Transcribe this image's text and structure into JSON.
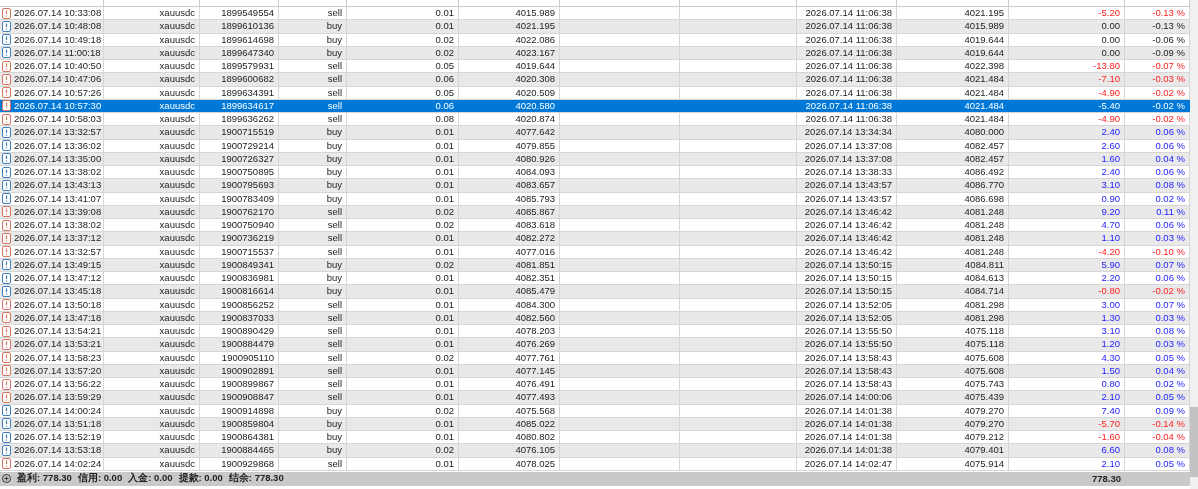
{
  "rows": [
    {
      "kind": "sell",
      "time": "2026.07.14 10:33:08",
      "symbol": "xauusdc",
      "ticket": "1899549554",
      "type": "sell",
      "volume": "0.01",
      "price": "4015.989",
      "close_time": "2026.07.14 11:06:38",
      "close_price": "4021.195",
      "profit": {
        "kind": "loss",
        "value": "-5.20",
        "pct": "-0.13 %"
      },
      "selected": false
    },
    {
      "kind": "buy",
      "time": "2026.07.14 10:48:08",
      "symbol": "xauusdc",
      "ticket": "1899610136",
      "type": "buy",
      "volume": "0.01",
      "price": "4021.195",
      "close_time": "2026.07.14 11:06:38",
      "close_price": "4015.989",
      "profit": {
        "kind": "even",
        "value": "0.00",
        "pct": "-0.13 %"
      },
      "selected": false
    },
    {
      "kind": "buy",
      "time": "2026.07.14 10:49:18",
      "symbol": "xauusdc",
      "ticket": "1899614698",
      "type": "buy",
      "volume": "0.02",
      "price": "4022.086",
      "close_time": "2026.07.14 11:06:38",
      "close_price": "4019.644",
      "profit": {
        "kind": "even",
        "value": "0.00",
        "pct": "-0.06 %"
      },
      "selected": false
    },
    {
      "kind": "buy",
      "time": "2026.07.14 11:00:18",
      "symbol": "xauusdc",
      "ticket": "1899647340",
      "type": "buy",
      "volume": "0.02",
      "price": "4023.167",
      "close_time": "2026.07.14 11:06:38",
      "close_price": "4019.644",
      "profit": {
        "kind": "even",
        "value": "0.00",
        "pct": "-0.09 %"
      },
      "selected": false
    },
    {
      "kind": "sell",
      "time": "2026.07.14 10:40:50",
      "symbol": "xauusdc",
      "ticket": "1899579931",
      "type": "sell",
      "volume": "0.05",
      "price": "4019.644",
      "close_time": "2026.07.14 11:06:38",
      "close_price": "4022.398",
      "profit": {
        "kind": "loss",
        "value": "-13.80",
        "pct": "-0.07 %"
      },
      "selected": false
    },
    {
      "kind": "sell",
      "time": "2026.07.14 10:47:06",
      "symbol": "xauusdc",
      "ticket": "1899600682",
      "type": "sell",
      "volume": "0.06",
      "price": "4020.308",
      "close_time": "2026.07.14 11:06:38",
      "close_price": "4021.484",
      "profit": {
        "kind": "loss",
        "value": "-7.10",
        "pct": "-0.03 %"
      },
      "selected": false
    },
    {
      "kind": "sell",
      "time": "2026.07.14 10:57:26",
      "symbol": "xauusdc",
      "ticket": "1899634391",
      "type": "sell",
      "volume": "0.05",
      "price": "4020.509",
      "close_time": "2026.07.14 11:06:38",
      "close_price": "4021.484",
      "profit": {
        "kind": "loss",
        "value": "-4.90",
        "pct": "-0.02 %"
      },
      "selected": false
    },
    {
      "kind": "sell",
      "time": "2026.07.14 10:57:30",
      "symbol": "xauusdc",
      "ticket": "1899634617",
      "type": "sell",
      "volume": "0.06",
      "price": "4020.580",
      "close_time": "2026.07.14 11:06:38",
      "close_price": "4021.484",
      "profit": {
        "value": "-5.40",
        "pct": "-0.02 %"
      },
      "selected": true
    },
    {
      "kind": "sell",
      "time": "2026.07.14 10:58:03",
      "symbol": "xauusdc",
      "ticket": "1899636262",
      "type": "sell",
      "volume": "0.08",
      "price": "4020.874",
      "close_time": "2026.07.14 11:06:38",
      "close_price": "4021.484",
      "profit": {
        "kind": "loss",
        "value": "-4.90",
        "pct": "-0.02 %"
      },
      "selected": false
    },
    {
      "kind": "buy",
      "time": "2026.07.14 13:32:57",
      "symbol": "xauusdc",
      "ticket": "1900715519",
      "type": "buy",
      "volume": "0.01",
      "price": "4077.642",
      "close_time": "2026.07.14 13:34:34",
      "close_price": "4080.000",
      "profit": {
        "kind": "gain",
        "value": "2.40",
        "pct": "0.06 %"
      },
      "selected": false
    },
    {
      "kind": "buy",
      "time": "2026.07.14 13:36:02",
      "symbol": "xauusdc",
      "ticket": "1900729214",
      "type": "buy",
      "volume": "0.01",
      "price": "4079.855",
      "close_time": "2026.07.14 13:37:08",
      "close_price": "4082.457",
      "profit": {
        "kind": "gain",
        "value": "2.60",
        "pct": "0.06 %"
      },
      "selected": false
    },
    {
      "kind": "buy",
      "time": "2026.07.14 13:35:00",
      "symbol": "xauusdc",
      "ticket": "1900726327",
      "type": "buy",
      "volume": "0.01",
      "price": "4080.926",
      "close_time": "2026.07.14 13:37:08",
      "close_price": "4082.457",
      "profit": {
        "kind": "gain",
        "value": "1.60",
        "pct": "0.04 %"
      },
      "selected": false
    },
    {
      "kind": "buy",
      "time": "2026.07.14 13:38:02",
      "symbol": "xauusdc",
      "ticket": "1900750895",
      "type": "buy",
      "volume": "0.01",
      "price": "4084.093",
      "close_time": "2026.07.14 13:38:33",
      "close_price": "4086.492",
      "profit": {
        "kind": "gain",
        "value": "2.40",
        "pct": "0.06 %"
      },
      "selected": false
    },
    {
      "kind": "buy",
      "time": "2026.07.14 13:43:13",
      "symbol": "xauusdc",
      "ticket": "1900795693",
      "type": "buy",
      "volume": "0.01",
      "price": "4083.657",
      "close_time": "2026.07.14 13:43:57",
      "close_price": "4086.770",
      "profit": {
        "kind": "gain",
        "value": "3.10",
        "pct": "0.08 %"
      },
      "selected": false
    },
    {
      "kind": "buy",
      "time": "2026.07.14 13:41:07",
      "symbol": "xauusdc",
      "ticket": "1900783409",
      "type": "buy",
      "volume": "0.01",
      "price": "4085.793",
      "close_time": "2026.07.14 13:43:57",
      "close_price": "4086.698",
      "profit": {
        "kind": "gain",
        "value": "0.90",
        "pct": "0.02 %"
      },
      "selected": false
    },
    {
      "kind": "sell",
      "time": "2026.07.14 13:39:08",
      "symbol": "xauusdc",
      "ticket": "1900762170",
      "type": "sell",
      "volume": "0.02",
      "price": "4085.867",
      "close_time": "2026.07.14 13:46:42",
      "close_price": "4081.248",
      "profit": {
        "kind": "gain",
        "value": "9.20",
        "pct": "0.11 %"
      },
      "selected": false
    },
    {
      "kind": "sell",
      "time": "2026.07.14 13:38:02",
      "symbol": "xauusdc",
      "ticket": "1900750940",
      "type": "sell",
      "volume": "0.02",
      "price": "4083.618",
      "close_time": "2026.07.14 13:46:42",
      "close_price": "4081.248",
      "profit": {
        "kind": "gain",
        "value": "4.70",
        "pct": "0.06 %"
      },
      "selected": false
    },
    {
      "kind": "sell",
      "time": "2026.07.14 13:37:12",
      "symbol": "xauusdc",
      "ticket": "1900736219",
      "type": "sell",
      "volume": "0.01",
      "price": "4082.272",
      "close_time": "2026.07.14 13:46:42",
      "close_price": "4081.248",
      "profit": {
        "kind": "gain",
        "value": "1.10",
        "pct": "0.03 %"
      },
      "selected": false
    },
    {
      "kind": "sell",
      "time": "2026.07.14 13:32:57",
      "symbol": "xauusdc",
      "ticket": "1900715537",
      "type": "sell",
      "volume": "0.01",
      "price": "4077.016",
      "close_time": "2026.07.14 13:46:42",
      "close_price": "4081.248",
      "profit": {
        "kind": "loss",
        "value": "-4.20",
        "pct": "-0.10 %"
      },
      "selected": false
    },
    {
      "kind": "buy",
      "time": "2026.07.14 13:49:15",
      "symbol": "xauusdc",
      "ticket": "1900849341",
      "type": "buy",
      "volume": "0.02",
      "price": "4081.851",
      "close_time": "2026.07.14 13:50:15",
      "close_price": "4084.811",
      "profit": {
        "kind": "gain",
        "value": "5.90",
        "pct": "0.07 %"
      },
      "selected": false
    },
    {
      "kind": "buy",
      "time": "2026.07.14 13:47:12",
      "symbol": "xauusdc",
      "ticket": "1900836981",
      "type": "buy",
      "volume": "0.01",
      "price": "4082.351",
      "close_time": "2026.07.14 13:50:15",
      "close_price": "4084.613",
      "profit": {
        "kind": "gain",
        "value": "2.20",
        "pct": "0.06 %"
      },
      "selected": false
    },
    {
      "kind": "buy",
      "time": "2026.07.14 13:45:18",
      "symbol": "xauusdc",
      "ticket": "1900816614",
      "type": "buy",
      "volume": "0.01",
      "price": "4085.479",
      "close_time": "2026.07.14 13:50:15",
      "close_price": "4084.714",
      "profit": {
        "kind": "loss",
        "value": "-0.80",
        "pct": "-0.02 %"
      },
      "selected": false
    },
    {
      "kind": "sell",
      "time": "2026.07.14 13:50:18",
      "symbol": "xauusdc",
      "ticket": "1900856252",
      "type": "sell",
      "volume": "0.01",
      "price": "4084.300",
      "close_time": "2026.07.14 13:52:05",
      "close_price": "4081.298",
      "profit": {
        "kind": "gain",
        "value": "3.00",
        "pct": "0.07 %"
      },
      "selected": false
    },
    {
      "kind": "sell",
      "time": "2026.07.14 13:47:18",
      "symbol": "xauusdc",
      "ticket": "1900837033",
      "type": "sell",
      "volume": "0.01",
      "price": "4082.560",
      "close_time": "2026.07.14 13:52:05",
      "close_price": "4081.298",
      "profit": {
        "kind": "gain",
        "value": "1.30",
        "pct": "0.03 %"
      },
      "selected": false
    },
    {
      "kind": "sell",
      "time": "2026.07.14 13:54:21",
      "symbol": "xauusdc",
      "ticket": "1900890429",
      "type": "sell",
      "volume": "0.01",
      "price": "4078.203",
      "close_time": "2026.07.14 13:55:50",
      "close_price": "4075.118",
      "profit": {
        "kind": "gain",
        "value": "3.10",
        "pct": "0.08 %"
      },
      "selected": false
    },
    {
      "kind": "sell",
      "time": "2026.07.14 13:53:21",
      "symbol": "xauusdc",
      "ticket": "1900884479",
      "type": "sell",
      "volume": "0.01",
      "price": "4076.269",
      "close_time": "2026.07.14 13:55:50",
      "close_price": "4075.118",
      "profit": {
        "kind": "gain",
        "value": "1.20",
        "pct": "0.03 %"
      },
      "selected": false
    },
    {
      "kind": "sell",
      "time": "2026.07.14 13:58:23",
      "symbol": "xauusdc",
      "ticket": "1900905110",
      "type": "sell",
      "volume": "0.02",
      "price": "4077.761",
      "close_time": "2026.07.14 13:58:43",
      "close_price": "4075.608",
      "profit": {
        "kind": "gain",
        "value": "4.30",
        "pct": "0.05 %"
      },
      "selected": false
    },
    {
      "kind": "sell",
      "time": "2026.07.14 13:57:20",
      "symbol": "xauusdc",
      "ticket": "1900902891",
      "type": "sell",
      "volume": "0.01",
      "price": "4077.145",
      "close_time": "2026.07.14 13:58:43",
      "close_price": "4075.608",
      "profit": {
        "kind": "gain",
        "value": "1.50",
        "pct": "0.04 %"
      },
      "selected": false
    },
    {
      "kind": "sell",
      "time": "2026.07.14 13:56:22",
      "symbol": "xauusdc",
      "ticket": "1900899867",
      "type": "sell",
      "volume": "0.01",
      "price": "4076.491",
      "close_time": "2026.07.14 13:58:43",
      "close_price": "4075.743",
      "profit": {
        "kind": "gain",
        "value": "0.80",
        "pct": "0.02 %"
      },
      "selected": false
    },
    {
      "kind": "sell",
      "time": "2026.07.14 13:59:29",
      "symbol": "xauusdc",
      "ticket": "1900908847",
      "type": "sell",
      "volume": "0.01",
      "price": "4077.493",
      "close_time": "2026.07.14 14:00:06",
      "close_price": "4075.439",
      "profit": {
        "kind": "gain",
        "value": "2.10",
        "pct": "0.05 %"
      },
      "selected": false
    },
    {
      "kind": "buy",
      "time": "2026.07.14 14:00:24",
      "symbol": "xauusdc",
      "ticket": "1900914898",
      "type": "buy",
      "volume": "0.02",
      "price": "4075.568",
      "close_time": "2026.07.14 14:01:38",
      "close_price": "4079.270",
      "profit": {
        "kind": "gain",
        "value": "7.40",
        "pct": "0.09 %"
      },
      "selected": false
    },
    {
      "kind": "buy",
      "time": "2026.07.14 13:51:18",
      "symbol": "xauusdc",
      "ticket": "1900859804",
      "type": "buy",
      "volume": "0.01",
      "price": "4085.022",
      "close_time": "2026.07.14 14:01:38",
      "close_price": "4079.270",
      "profit": {
        "kind": "loss",
        "value": "-5.70",
        "pct": "-0.14 %"
      },
      "selected": false
    },
    {
      "kind": "buy",
      "time": "2026.07.14 13:52:19",
      "symbol": "xauusdc",
      "ticket": "1900864381",
      "type": "buy",
      "volume": "0.01",
      "price": "4080.802",
      "close_time": "2026.07.14 14:01:38",
      "close_price": "4079.212",
      "profit": {
        "kind": "loss",
        "value": "-1.60",
        "pct": "-0.04 %"
      },
      "selected": false
    },
    {
      "kind": "buy",
      "time": "2026.07.14 13:53:18",
      "symbol": "xauusdc",
      "ticket": "1900884465",
      "type": "buy",
      "volume": "0.02",
      "price": "4076.105",
      "close_time": "2026.07.14 14:01:38",
      "close_price": "4079.401",
      "profit": {
        "kind": "gain",
        "value": "6.60",
        "pct": "0.08 %"
      },
      "selected": false
    },
    {
      "kind": "sell",
      "time": "2026.07.14 14:02:24",
      "symbol": "xauusdc",
      "ticket": "1900929868",
      "type": "sell",
      "volume": "0.01",
      "price": "4078.025",
      "close_time": "2026.07.14 14:02:47",
      "close_price": "4075.914",
      "profit": {
        "kind": "gain",
        "value": "2.10",
        "pct": "0.05 %"
      },
      "selected": false
    }
  ],
  "summary": {
    "items": [
      {
        "label": "盈利:",
        "value": "778.30"
      },
      {
        "label": "信用:",
        "value": "0.00"
      },
      {
        "label": "入金:",
        "value": "0.00"
      },
      {
        "label": "提款:",
        "value": "0.00"
      },
      {
        "label": "结余:",
        "value": "778.30"
      }
    ],
    "total": "778.30"
  }
}
